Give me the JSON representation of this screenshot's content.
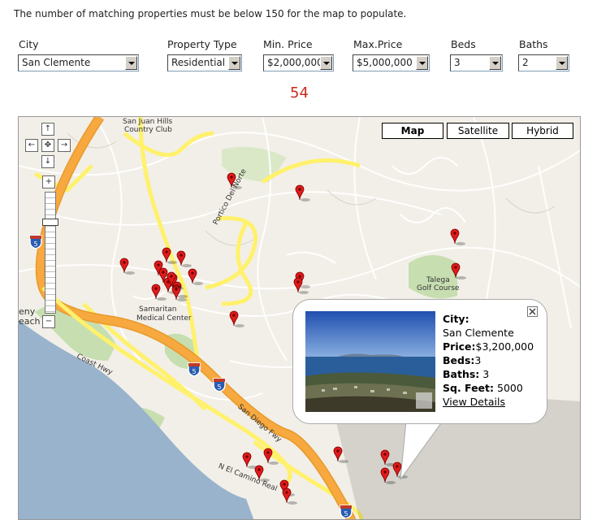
{
  "notice": "The number of matching properties must be below 150 for the map to populate.",
  "filters": {
    "city": {
      "label": "City",
      "value": "San Clemente"
    },
    "property_type": {
      "label": "Property Type",
      "value": "Residential"
    },
    "min_price": {
      "label": "Min. Price",
      "value": "$2,000,000"
    },
    "max_price": {
      "label": "Max.Price",
      "value": "$5,000,000"
    },
    "beds": {
      "label": "Beds",
      "value": "3"
    },
    "baths": {
      "label": "Baths",
      "value": "2"
    }
  },
  "match_count": "54",
  "map": {
    "types": [
      "Map",
      "Satellite",
      "Hybrid"
    ],
    "active_type": "Map",
    "labels": {
      "country_club_1": "San Juan Hills",
      "country_club_2": "Country Club",
      "road_portico": "Portico Del Norte",
      "talega_1": "Talega",
      "talega_2": "Golf Course",
      "samaritan_1": "Samaritan",
      "samaritan_2": "Medical Center",
      "coast_hwy": "Coast Hwy",
      "san_diego_fwy": "San Diego Fwy",
      "el_camino": "N El Camino Real",
      "beach_1": "eny",
      "beach_2": "each",
      "shield": "5"
    }
  },
  "popup": {
    "city_label": "City:",
    "city_value": "San Clemente",
    "price_label": "Price:",
    "price_value": "$3,200,000",
    "beds_label": "Beds:",
    "beds_value": "3",
    "baths_label": "Baths:",
    "baths_value": " 3",
    "sqft_label": "Sq. Feet:",
    "sqft_value": " 5000",
    "details_link": "View Details"
  },
  "colors": {
    "count": "#cc2a1b",
    "water": "#99b3cc",
    "highway": "#f7a940",
    "road_yellow": "#fff16b",
    "land": "#f2efe8",
    "park": "#c7deb0",
    "marker": "#e01a1a"
  }
}
